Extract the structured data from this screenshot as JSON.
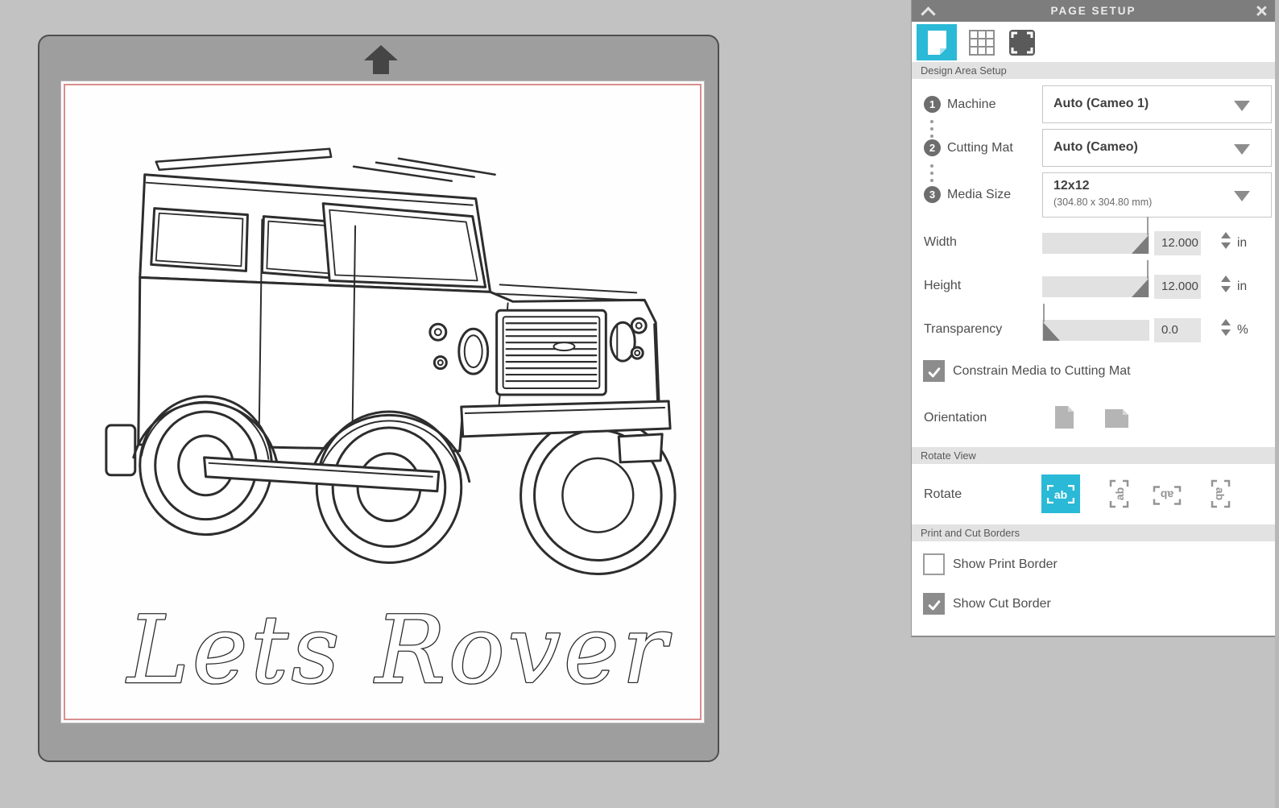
{
  "colors": {
    "accent": "#2ab9d6",
    "mat_gray": "#9e9e9e",
    "page_border_red": "#d98f8f",
    "panel_header_gray": "#7d7d7d",
    "section_bar_gray": "#e2e2e2"
  },
  "canvas": {
    "design_text": "Lets Rover"
  },
  "panel": {
    "title": "PAGE SETUP",
    "tabs": [
      {
        "name": "design-page-settings",
        "selected": true
      },
      {
        "name": "grid-settings",
        "selected": false
      },
      {
        "name": "registration-marks",
        "selected": false
      }
    ],
    "design_area": {
      "header": "Design Area Setup",
      "steps": [
        {
          "num": "1",
          "label": "Machine",
          "value": "Auto (Cameo 1)"
        },
        {
          "num": "2",
          "label": "Cutting Mat",
          "value": "Auto (Cameo)"
        },
        {
          "num": "3",
          "label": "Media Size",
          "value": "12x12",
          "value_detail": "(304.80 x 304.80 mm)"
        }
      ],
      "width": {
        "label": "Width",
        "value": "12.000",
        "unit": "in"
      },
      "height": {
        "label": "Height",
        "value": "12.000",
        "unit": "in"
      },
      "transparency": {
        "label": "Transparency",
        "value": "0.0",
        "unit": "%"
      },
      "constrain": {
        "label": "Constrain Media to Cutting Mat",
        "checked": true
      },
      "orientation": {
        "label": "Orientation",
        "options": [
          "portrait",
          "landscape"
        ]
      }
    },
    "rotate_view": {
      "header": "Rotate View",
      "label": "Rotate",
      "icon_text": "ab",
      "options": [
        "0",
        "90",
        "180",
        "270"
      ],
      "selected": "0"
    },
    "print_cut_borders": {
      "header": "Print and Cut Borders",
      "show_print_border": {
        "label": "Show Print Border",
        "checked": false
      },
      "show_cut_border": {
        "label": "Show Cut Border",
        "checked": true
      }
    }
  }
}
